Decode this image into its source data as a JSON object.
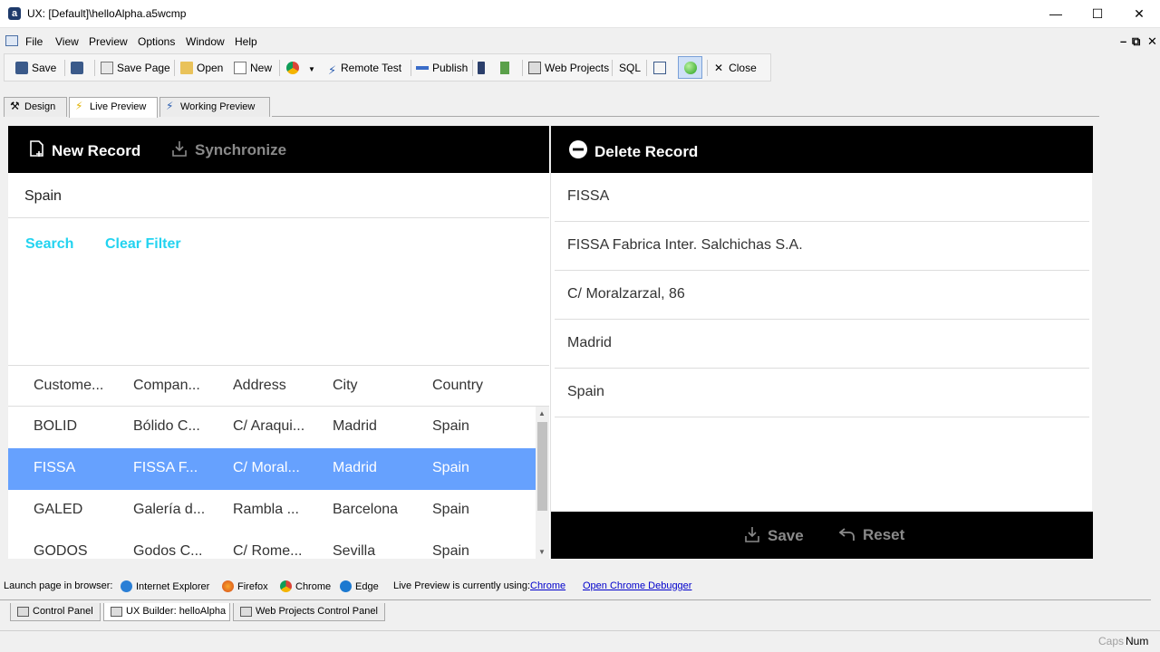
{
  "window": {
    "title": "UX: [Default]\\helloAlpha.a5wcmp",
    "logo": "a"
  },
  "menu": [
    "File",
    "View",
    "Preview",
    "Options",
    "Window",
    "Help"
  ],
  "toolbar": {
    "save": "Save",
    "save_page": "Save Page",
    "open": "Open",
    "new": "New",
    "remote_test": "Remote Test",
    "publish": "Publish",
    "web_projects": "Web Projects",
    "sql": "SQL",
    "close": "Close"
  },
  "tabs": {
    "design": "Design",
    "live_preview": "Live Preview",
    "working_preview": "Working Preview"
  },
  "preview": {
    "new_record": "New Record",
    "synchronize": "Synchronize",
    "delete_record": "Delete Record",
    "search_value": "Spain",
    "search_btn": "Search",
    "clear_filter_btn": "Clear Filter",
    "columns": [
      "Custome...",
      "Compan...",
      "Address",
      "City",
      "Country"
    ],
    "rows": [
      [
        "BOLID",
        "Bólido C...",
        "C/ Araqui...",
        "Madrid",
        "Spain"
      ],
      [
        "FISSA",
        "FISSA F...",
        "C/ Moral...",
        "Madrid",
        "Spain"
      ],
      [
        "GALED",
        "Galería d...",
        "Rambla ...",
        "Barcelona",
        "Spain"
      ],
      [
        "GODOS",
        "Godos C...",
        "C/ Rome...",
        "Sevilla",
        "Spain"
      ]
    ],
    "selected_row": 1,
    "detail_fields": [
      "FISSA",
      "FISSA Fabrica Inter. Salchichas S.A.",
      "C/ Moralzarzal, 86",
      "Madrid",
      "Spain"
    ],
    "save": "Save",
    "reset": "Reset"
  },
  "launch": {
    "label": "Launch page in browser:",
    "internet_explorer": "Internet Explorer",
    "firefox": "Firefox",
    "chrome": "Chrome",
    "edge": "Edge",
    "using_label": "Live Preview is currently using:",
    "using_value": "Chrome",
    "debugger": "Open Chrome Debugger"
  },
  "bottom_tabs": {
    "control_panel": "Control Panel",
    "ux_builder": "UX Builder: helloAlpha",
    "web_projects_cp": "Web Projects Control Panel"
  },
  "status": {
    "caps": "Caps",
    "num": "Num"
  },
  "colors": {
    "accent": "#23d3f0",
    "selected_row": "#66a1fe",
    "bar": "#000000"
  }
}
